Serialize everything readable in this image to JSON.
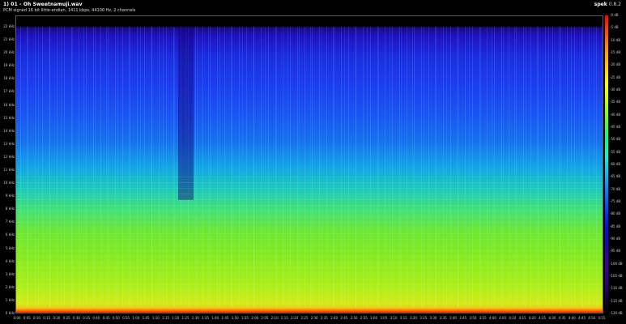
{
  "header": {
    "title": "1) 01 - Oh Sweetnamuji.wav",
    "subtitle": "PCM signed 16 bit little-endian, 1411 kbps, 44100 Hz, 2 channels",
    "app_name": "spek",
    "app_version": "0.8.2"
  },
  "freq_axis": [
    "22 kHz",
    "21 kHz",
    "20 kHz",
    "19 kHz",
    "18 kHz",
    "17 kHz",
    "16 kHz",
    "15 kHz",
    "14 kHz",
    "13 kHz",
    "12 kHz",
    "11 kHz",
    "10 kHz",
    "9 kHz",
    "8 kHz",
    "7 kHz",
    "6 kHz",
    "5 kHz",
    "4 kHz",
    "3 kHz",
    "2 kHz",
    "1 kHz",
    "0 kHz"
  ],
  "time_axis": [
    "0:00",
    "0:05",
    "0:10",
    "0:15",
    "0:20",
    "0:25",
    "0:30",
    "0:35",
    "0:40",
    "0:45",
    "0:50",
    "0:55",
    "1:00",
    "1:05",
    "1:10",
    "1:15",
    "1:20",
    "1:25",
    "1:30",
    "1:35",
    "1:40",
    "1:45",
    "1:50",
    "1:55",
    "2:00",
    "2:05",
    "2:10",
    "2:15",
    "2:20",
    "2:25",
    "2:30",
    "2:35",
    "2:40",
    "2:45",
    "2:50",
    "2:55",
    "3:00",
    "3:05",
    "3:10",
    "3:15",
    "3:20",
    "3:25",
    "3:30",
    "3:35",
    "3:40",
    "3:45",
    "3:50",
    "3:55",
    "4:00",
    "4:05",
    "4:10",
    "4:15",
    "4:20",
    "4:25",
    "4:30",
    "4:35",
    "4:40",
    "4:45",
    "4:50",
    "4:55"
  ],
  "db_axis": [
    "-0 dB",
    "-5 dB",
    "-10 dB",
    "-15 dB",
    "-20 dB",
    "-25 dB",
    "-30 dB",
    "-35 dB",
    "-40 dB",
    "-45 dB",
    "-50 dB",
    "-55 dB",
    "-60 dB",
    "-65 dB",
    "-70 dB",
    "-75 dB",
    "-80 dB",
    "-85 dB",
    "-90 dB",
    "-95 dB",
    "-100 dB",
    "-105 dB",
    "-110 dB",
    "-115 dB",
    "-120 dB"
  ],
  "colors": {
    "background": "#000000",
    "low_freq": "#9cec1c",
    "high_freq": "#1c3ff0",
    "peak": "#ff2a00"
  }
}
